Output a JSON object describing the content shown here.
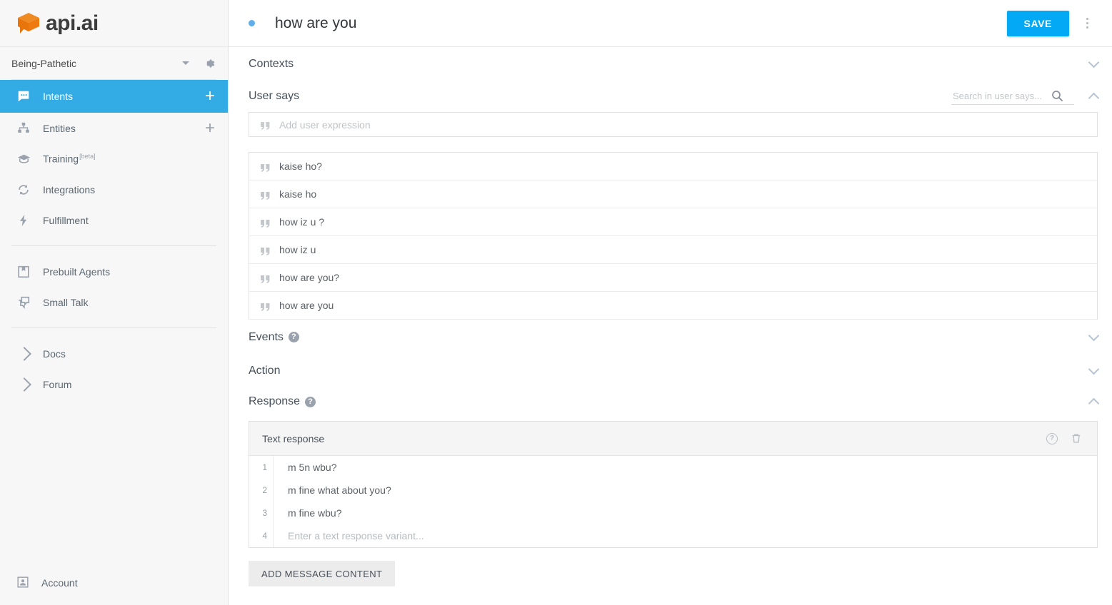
{
  "brand": {
    "logo_text": "api.ai",
    "logo_color": "#ee7a10"
  },
  "sidebar": {
    "agent": {
      "name": "Being-Pathetic"
    },
    "items": [
      {
        "label": "Intents",
        "icon": "chat-bubble-icon",
        "active": true,
        "has_add": true
      },
      {
        "label": "Entities",
        "icon": "hierarchy-icon",
        "active": false,
        "has_add": true
      },
      {
        "label": "Training",
        "icon": "graduation-cap-icon",
        "active": false,
        "has_add": false,
        "badge": "[beta]"
      },
      {
        "label": "Integrations",
        "icon": "sync-icon",
        "active": false,
        "has_add": false
      },
      {
        "label": "Fulfillment",
        "icon": "bolt-icon",
        "active": false,
        "has_add": false
      }
    ],
    "items2": [
      {
        "label": "Prebuilt Agents",
        "icon": "book-icon"
      },
      {
        "label": "Small Talk",
        "icon": "chat-stack-icon"
      }
    ],
    "items3": [
      {
        "label": "Docs",
        "icon": "chevron-right-icon"
      },
      {
        "label": "Forum",
        "icon": "chevron-right-icon"
      }
    ],
    "account": {
      "label": "Account",
      "icon": "person-box-icon"
    }
  },
  "topbar": {
    "intent_title": "how are you",
    "save_label": "SAVE",
    "accent_color": "#03a9f4",
    "dot_color": "#5fadea"
  },
  "sections": {
    "contexts": {
      "label": "Contexts",
      "collapsed": true
    },
    "user_says": {
      "label": "User says",
      "collapsed": false
    },
    "events": {
      "label": "Events",
      "collapsed": true,
      "has_help": true
    },
    "action": {
      "label": "Action",
      "collapsed": true
    },
    "response": {
      "label": "Response",
      "collapsed": false,
      "has_help": true
    }
  },
  "user_says": {
    "search_placeholder": "Search in user says...",
    "add_placeholder": "Add user expression",
    "items": [
      "kaise ho?",
      "kaise ho",
      "how iz u ?",
      "how iz u",
      "how are you?",
      "how are you"
    ]
  },
  "response": {
    "card_title": "Text response",
    "rows": [
      {
        "num": "1",
        "text": "m 5n wbu?",
        "placeholder": false
      },
      {
        "num": "2",
        "text": "m fine what about you?",
        "placeholder": false
      },
      {
        "num": "3",
        "text": "m fine wbu?",
        "placeholder": false
      },
      {
        "num": "4",
        "text": "Enter a text response variant...",
        "placeholder": true
      }
    ],
    "add_message_label": "ADD MESSAGE CONTENT"
  }
}
